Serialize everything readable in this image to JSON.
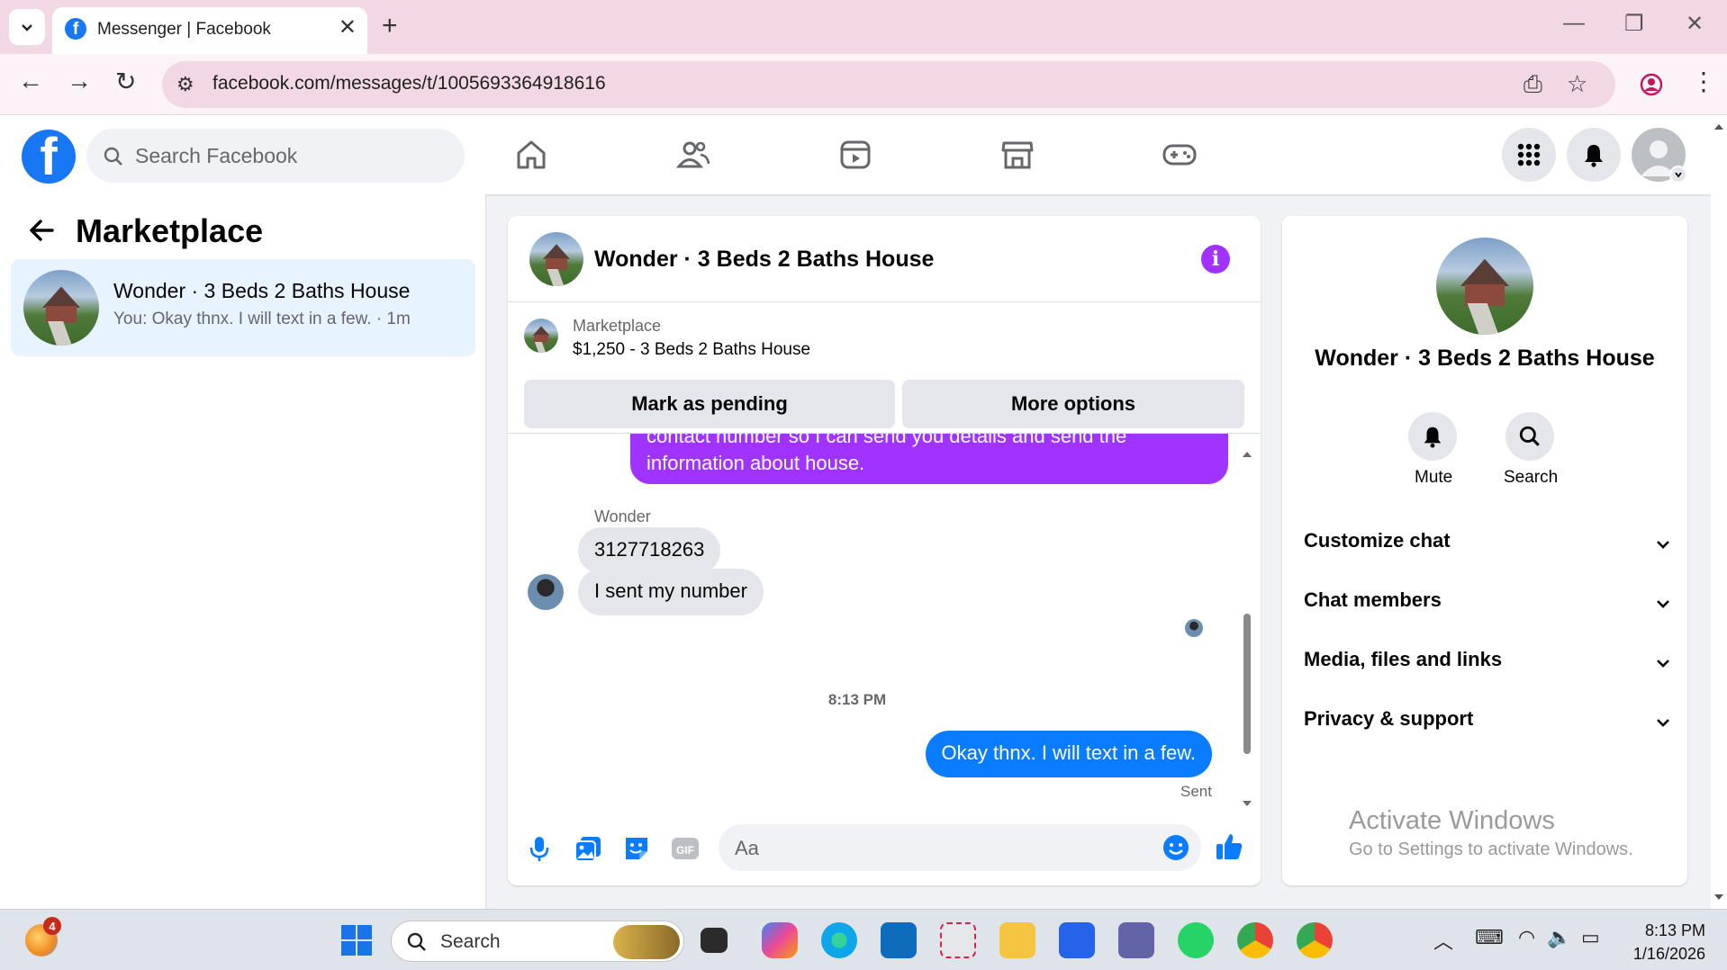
{
  "browser": {
    "tab_title": "Messenger | Facebook",
    "url": "facebook.com/messages/t/1005693364918616"
  },
  "fb": {
    "search_placeholder": "Search Facebook"
  },
  "left": {
    "heading": "Marketplace",
    "conversation": {
      "name": "Wonder · 3 Beds 2 Baths House",
      "snippet": "You: Okay thnx. I will text in a few. · 1m"
    }
  },
  "chat": {
    "title": "Wonder · 3 Beds 2 Baths House",
    "listing_category": "Marketplace",
    "listing_price": "$1,250 - 3 Beds 2 Baths House",
    "mark_pending": "Mark as pending",
    "more_options": "More options",
    "purple_message_line1": "contact number so I can send you details and send the",
    "purple_message_line2": "information about house.",
    "sender": "Wonder",
    "msg_number": "3127718263",
    "msg_sent_number": "I sent my number",
    "timestamp": "8:13 PM",
    "my_message": "Okay thnx. I will text in a few.",
    "status": "Sent",
    "input_placeholder": "Aa"
  },
  "right": {
    "name": "Wonder · 3 Beds 2 Baths House",
    "mute": "Mute",
    "search": "Search",
    "sections": [
      "Customize chat",
      "Chat members",
      "Media, files and links",
      "Privacy & support"
    ]
  },
  "watermark": {
    "line1": "Activate Windows",
    "line2": "Go to Settings to activate Windows."
  },
  "taskbar": {
    "search_label": "Search",
    "badge_count": "4",
    "time": "8:13 PM",
    "date": "1/16/2026"
  },
  "colors": {
    "fb_blue": "#1877f2",
    "messenger_blue": "#0a7cff",
    "purple": "#a033ff"
  }
}
